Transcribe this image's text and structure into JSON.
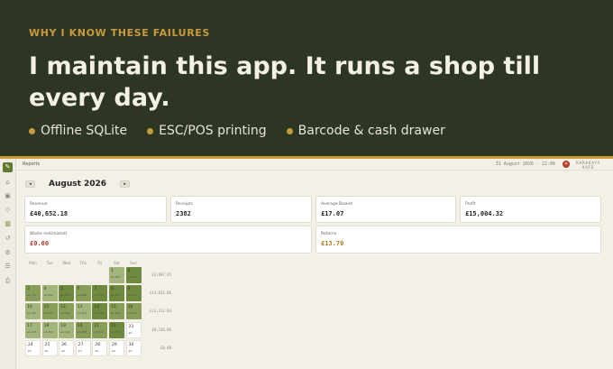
{
  "promo": {
    "eyebrow": "WHY I KNOW THESE FAILURES",
    "headline": "I maintain this app. It runs a shop till every day.",
    "bullets": [
      "Offline SQLite",
      "ESC/POS printing",
      "Barcode & cash drawer"
    ]
  },
  "app": {
    "breadcrumb": "Reports",
    "datetime": "31 August 2026 · 22:06",
    "brand_line1": "KARAKAYA",
    "brand_line2": "KAFE",
    "month_label": "August 2026",
    "prev_label": "◂",
    "next_label": "▸",
    "cards": [
      {
        "label": "Revenue",
        "value": "£40,652.18",
        "tone": ""
      },
      {
        "label": "Receipts",
        "value": "2382",
        "tone": ""
      },
      {
        "label": "Average Basket",
        "value": "£17.07",
        "tone": ""
      },
      {
        "label": "Profit",
        "value": "£15,004.32",
        "tone": ""
      },
      {
        "label": "Waste (estimated)",
        "value": "£0.00",
        "tone": "red"
      },
      {
        "label": "Returns",
        "value": "£13.70",
        "tone": "amber"
      }
    ],
    "weekdays": [
      "Mon",
      "Tue",
      "Wed",
      "Thu",
      "Fri",
      "Sat",
      "Sun"
    ],
    "week_totals": [
      "£3,697.41",
      "£14,032.06",
      "£13,412.03",
      "£9,536.06",
      "£0.00"
    ],
    "days": [
      {
        "d": "1",
        "s": "£1,842",
        "lvl": 1
      },
      {
        "d": "2",
        "s": "£1,855",
        "lvl": 3
      },
      {
        "d": "3",
        "s": "£1,713",
        "lvl": 2
      },
      {
        "d": "4",
        "s": "£1,620",
        "lvl": 1
      },
      {
        "d": "5",
        "s": "£2,270",
        "lvl": 3
      },
      {
        "d": "6",
        "s": "£1,688",
        "lvl": 2
      },
      {
        "d": "7",
        "s": "£2,104",
        "lvl": 3
      },
      {
        "d": "8",
        "s": "£2,431",
        "lvl": 3
      },
      {
        "d": "9",
        "s": "£2,219",
        "lvl": 3
      },
      {
        "d": "10",
        "s": "£1,587",
        "lvl": 1
      },
      {
        "d": "11",
        "s": "£1,902",
        "lvl": 2
      },
      {
        "d": "12",
        "s": "£2,006",
        "lvl": 2
      },
      {
        "d": "13",
        "s": "£1,822",
        "lvl": 1
      },
      {
        "d": "14",
        "s": "£2,388",
        "lvl": 3
      },
      {
        "d": "15",
        "s": "£1,930",
        "lvl": 2
      },
      {
        "d": "16",
        "s": "£1,777",
        "lvl": 2
      },
      {
        "d": "17",
        "s": "£1,495",
        "lvl": 1
      },
      {
        "d": "18",
        "s": "£1,366",
        "lvl": 1
      },
      {
        "d": "19",
        "s": "£1,244",
        "lvl": 1
      },
      {
        "d": "20",
        "s": "£1,618",
        "lvl": 2
      },
      {
        "d": "21",
        "s": "£1,511",
        "lvl": 2
      },
      {
        "d": "22",
        "s": "£2,302",
        "lvl": 3
      },
      {
        "d": "23",
        "s": "£0",
        "lvl": 0
      },
      {
        "d": "24",
        "s": "£0",
        "lvl": 0
      },
      {
        "d": "25",
        "s": "£0",
        "lvl": 0
      },
      {
        "d": "26",
        "s": "£0",
        "lvl": 0
      },
      {
        "d": "27",
        "s": "£0",
        "lvl": 0
      },
      {
        "d": "28",
        "s": "£0",
        "lvl": 0
      },
      {
        "d": "29",
        "s": "£0",
        "lvl": 0
      },
      {
        "d": "30",
        "s": "£0",
        "lvl": 0
      }
    ]
  }
}
